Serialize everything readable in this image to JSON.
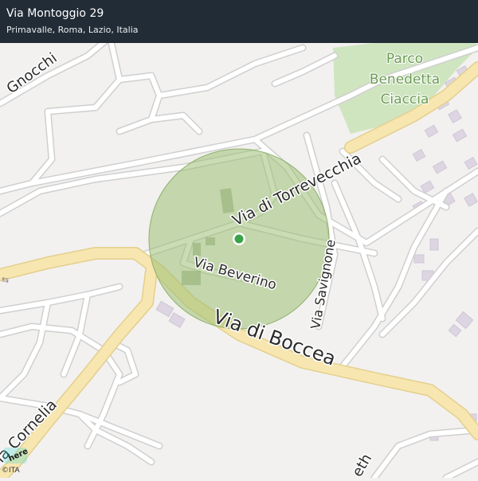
{
  "header": {
    "title": "Via Montoggio 29",
    "subtitle": "Primavalle, Roma, Lazio, Italia"
  },
  "map": {
    "park_label_line1": "Parco",
    "park_label_line2": "Benedetta",
    "park_label_line3": "Ciaccia",
    "street_gnocchi": "Gnocchi",
    "street_torrevecchia": "Via  di  Torrevecchia",
    "street_beverino": "Via  Beverino",
    "street_savignone": "Via  Savignone",
    "street_boccea": "Via  di   Boccea",
    "street_cornelia": "ia  Cornelia",
    "street_partial": "eth"
  },
  "attribution": {
    "logo_text": "here",
    "copyright": "©ITA"
  },
  "colors": {
    "header_bg": "#222c36",
    "map_bg": "#f2f1ef",
    "park": "#cfe5c0",
    "radius_fill": "#9dbf75",
    "main_road": "#f7e6b0",
    "main_road_edge": "#e4cf8d",
    "minor_road": "#ffffff",
    "minor_road_edge": "#cfcfcf",
    "building": "#ddd6e2",
    "location_dot": "#3aa349"
  }
}
